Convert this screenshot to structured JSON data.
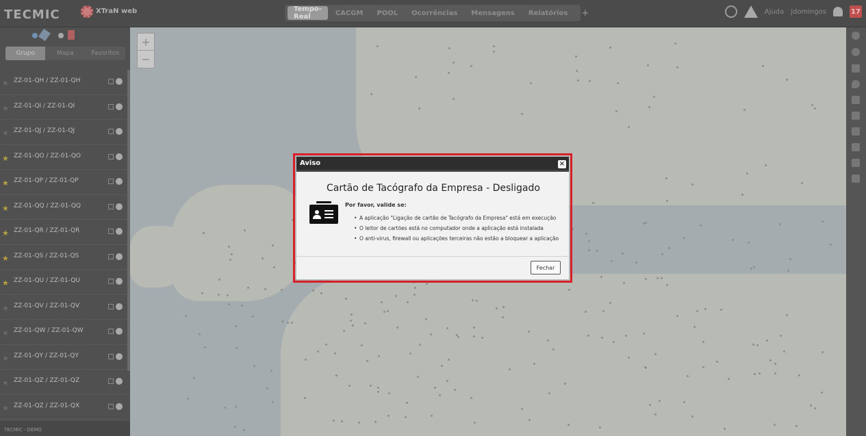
{
  "topbar": {
    "logo": "TECMIC",
    "product": "XTraN web",
    "tabs": [
      "Tempo-Real",
      "CACGM",
      "POOL",
      "Ocorrências",
      "Mensagens",
      "Relatórios",
      "+"
    ],
    "active_tab": "Tempo-Real",
    "help_label": "Ajuda",
    "username": "jdomingos",
    "notification_count": "17"
  },
  "sidebar": {
    "tabs": [
      "Grupo",
      "Mapa",
      "Favoritos"
    ],
    "vehicles": [
      {
        "name": "ZZ-01-QH / ZZ-01-QH",
        "favorite": false
      },
      {
        "name": "ZZ-01-QI / ZZ-01-QI",
        "favorite": false
      },
      {
        "name": "ZZ-01-QJ / ZZ-01-QJ",
        "favorite": false
      },
      {
        "name": "ZZ-01-QO / ZZ-01-QO",
        "favorite": true
      },
      {
        "name": "ZZ-01-QP / ZZ-01-QP",
        "favorite": true
      },
      {
        "name": "ZZ-01-QQ / ZZ-01-QQ",
        "favorite": true
      },
      {
        "name": "ZZ-01-QR / ZZ-01-QR",
        "favorite": true
      },
      {
        "name": "ZZ-01-QS / ZZ-01-QS",
        "favorite": true
      },
      {
        "name": "ZZ-01-QU / ZZ-01-QU",
        "favorite": true
      },
      {
        "name": "ZZ-01-QV / ZZ-01-QV",
        "favorite": false
      },
      {
        "name": "ZZ-01-QW / ZZ-01-QW",
        "favorite": false
      },
      {
        "name": "ZZ-01-QY / ZZ-01-QY",
        "favorite": false
      },
      {
        "name": "ZZ-01-QZ / ZZ-01-QZ",
        "favorite": false
      },
      {
        "name": "ZZ-01-QZ / ZZ-01-QX",
        "favorite": false
      }
    ],
    "footer": "TECMIC - DEMO"
  },
  "map": {
    "zoom_in": "+",
    "zoom_out": "−"
  },
  "dialog": {
    "title": "Aviso",
    "close": "×",
    "heading": "Cartão de Tacógrafo da Empresa - Desligado",
    "intro": "Por favor, valide se:",
    "items": [
      "A aplicação \"Ligação de cartão de Tacógrafo da Empresa\" está em execução",
      "O leitor de cartões está no computador onde a aplicação está instalada",
      "O anti-virus, firewall ou aplicações terceiras não estão a bloquear a aplicação"
    ],
    "close_button": "Fechar"
  },
  "colors": {
    "highlight": "#d8202a",
    "overlay_topbar": "#4b4b4b",
    "dialog_title_bg": "#2e2e2e"
  }
}
